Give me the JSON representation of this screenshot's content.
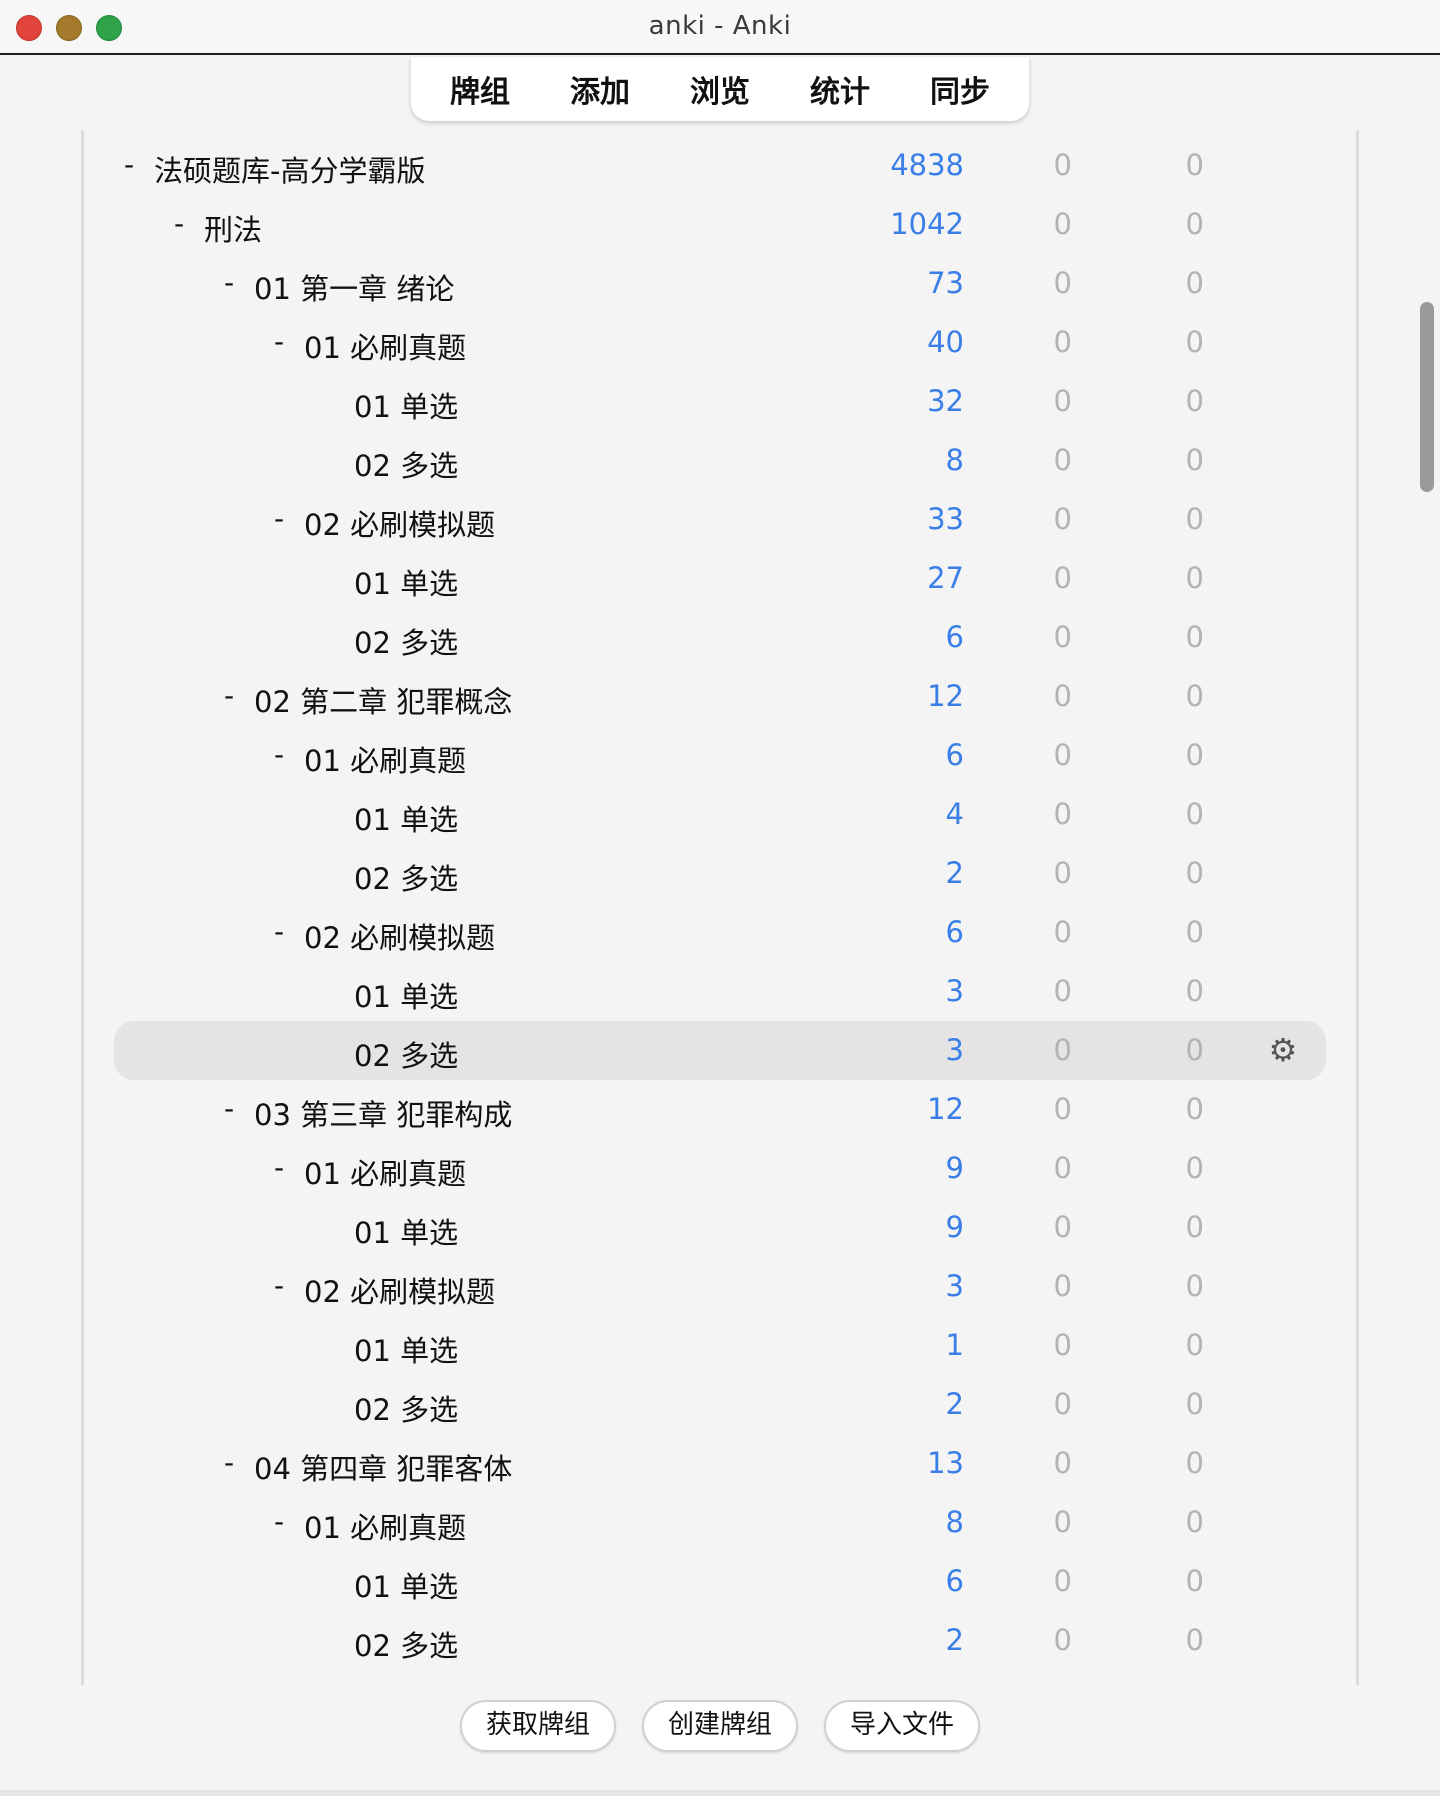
{
  "window": {
    "title": "anki - Anki"
  },
  "toolbar": {
    "items": [
      {
        "label": "牌组"
      },
      {
        "label": "添加"
      },
      {
        "label": "浏览"
      },
      {
        "label": "统计"
      },
      {
        "label": "同步"
      }
    ]
  },
  "decks": [
    {
      "name": "法硕题库-高分学霸版",
      "level": 0,
      "collapse": "-",
      "new": "4838",
      "learn": "0",
      "review": "0"
    },
    {
      "name": "刑法",
      "level": 1,
      "collapse": "-",
      "new": "1042",
      "learn": "0",
      "review": "0"
    },
    {
      "name": "01 第一章 绪论",
      "level": 2,
      "collapse": "-",
      "new": "73",
      "learn": "0",
      "review": "0"
    },
    {
      "name": "01 必刷真题",
      "level": 3,
      "collapse": "-",
      "new": "40",
      "learn": "0",
      "review": "0"
    },
    {
      "name": "01 单选",
      "level": 4,
      "collapse": "",
      "new": "32",
      "learn": "0",
      "review": "0"
    },
    {
      "name": "02 多选",
      "level": 4,
      "collapse": "",
      "new": "8",
      "learn": "0",
      "review": "0"
    },
    {
      "name": "02 必刷模拟题",
      "level": 3,
      "collapse": "-",
      "new": "33",
      "learn": "0",
      "review": "0"
    },
    {
      "name": "01 单选",
      "level": 4,
      "collapse": "",
      "new": "27",
      "learn": "0",
      "review": "0"
    },
    {
      "name": "02 多选",
      "level": 4,
      "collapse": "",
      "new": "6",
      "learn": "0",
      "review": "0"
    },
    {
      "name": "02 第二章 犯罪概念",
      "level": 2,
      "collapse": "-",
      "new": "12",
      "learn": "0",
      "review": "0"
    },
    {
      "name": "01 必刷真题",
      "level": 3,
      "collapse": "-",
      "new": "6",
      "learn": "0",
      "review": "0"
    },
    {
      "name": "01 单选",
      "level": 4,
      "collapse": "",
      "new": "4",
      "learn": "0",
      "review": "0"
    },
    {
      "name": "02 多选",
      "level": 4,
      "collapse": "",
      "new": "2",
      "learn": "0",
      "review": "0"
    },
    {
      "name": "02 必刷模拟题",
      "level": 3,
      "collapse": "-",
      "new": "6",
      "learn": "0",
      "review": "0"
    },
    {
      "name": "01 单选",
      "level": 4,
      "collapse": "",
      "new": "3",
      "learn": "0",
      "review": "0"
    },
    {
      "name": "02 多选",
      "level": 4,
      "collapse": "",
      "new": "3",
      "learn": "0",
      "review": "0",
      "current": true
    },
    {
      "name": "03 第三章 犯罪构成",
      "level": 2,
      "collapse": "-",
      "new": "12",
      "learn": "0",
      "review": "0"
    },
    {
      "name": "01 必刷真题",
      "level": 3,
      "collapse": "-",
      "new": "9",
      "learn": "0",
      "review": "0"
    },
    {
      "name": "01 单选",
      "level": 4,
      "collapse": "",
      "new": "9",
      "learn": "0",
      "review": "0"
    },
    {
      "name": "02 必刷模拟题",
      "level": 3,
      "collapse": "-",
      "new": "3",
      "learn": "0",
      "review": "0"
    },
    {
      "name": "01 单选",
      "level": 4,
      "collapse": "",
      "new": "1",
      "learn": "0",
      "review": "0"
    },
    {
      "name": "02 多选",
      "level": 4,
      "collapse": "",
      "new": "2",
      "learn": "0",
      "review": "0"
    },
    {
      "name": "04 第四章 犯罪客体",
      "level": 2,
      "collapse": "-",
      "new": "13",
      "learn": "0",
      "review": "0"
    },
    {
      "name": "01 必刷真题",
      "level": 3,
      "collapse": "-",
      "new": "8",
      "learn": "0",
      "review": "0"
    },
    {
      "name": "01 单选",
      "level": 4,
      "collapse": "",
      "new": "6",
      "learn": "0",
      "review": "0"
    },
    {
      "name": "02 多选",
      "level": 4,
      "collapse": "",
      "new": "2",
      "learn": "0",
      "review": "0"
    }
  ],
  "icons": {
    "options": "gear-icon"
  },
  "bottom": {
    "get_shared_label": "获取牌组",
    "create_deck_label": "创建牌组",
    "import_file_label": "导入文件"
  },
  "colors": {
    "new_count": "#3a7ee8",
    "zero_count": "#b3b3b3",
    "close": "#e0443a",
    "minimize": "#a47a2c",
    "maximize": "#2fa24a"
  }
}
